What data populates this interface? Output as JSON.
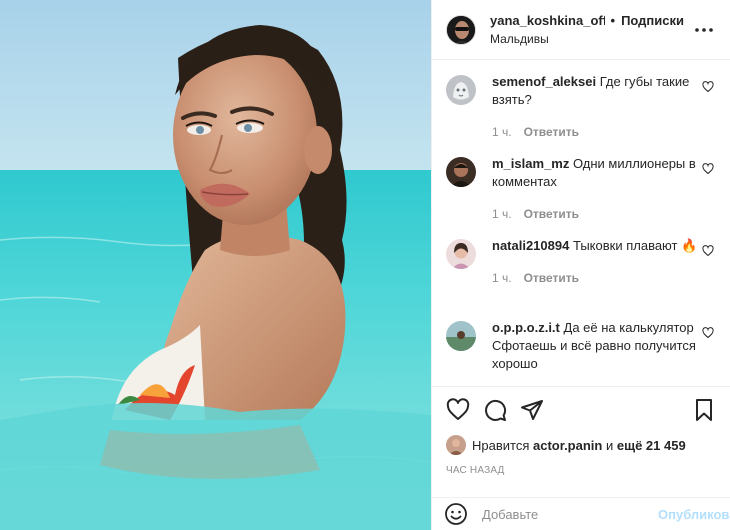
{
  "post": {
    "author": "yana_koshkina_offic",
    "separator": "•",
    "follow_label": "Подписки",
    "location": "Мальдивы",
    "more_icon": "more-horizontal-icon"
  },
  "comments": [
    {
      "username": "semenof_aleksei",
      "text": "Где губы такие взять?",
      "time": "1 ч.",
      "reply": "Ответить",
      "avatar_color": "#c9c9c9"
    },
    {
      "username": "m_islam_mz",
      "text": "Одни миллионеры в комментах",
      "time": "1 ч.",
      "reply": "Ответить",
      "avatar_color": "#5a4639"
    },
    {
      "username": "natali210894",
      "text": "Тыковки плавают 🔥",
      "time": "1 ч.",
      "reply": "Ответить",
      "avatar_color": "#e9d6d6"
    },
    {
      "username": "o.p.p.o.z.i.t",
      "text": "Да её на калькулятор Сфотаешь и всё равно получится хорошо",
      "avatar_color": "#6f8c6b"
    }
  ],
  "actions": {
    "like_icon": "heart-icon",
    "comment_icon": "comment-icon",
    "share_icon": "send-icon",
    "save_icon": "bookmark-icon"
  },
  "likes": {
    "prefix": "Нравится",
    "user": "actor.panin",
    "middle": "и",
    "rest": "ещё 21 459"
  },
  "time_ago": "ЧАС НАЗАД",
  "composer": {
    "placeholder": "Добавьте",
    "publish_label": "Опубликовать",
    "emoji_icon": "smile-icon"
  },
  "colors": {
    "primary_text": "#262626",
    "secondary_text": "#8e8e8e",
    "publish_disabled": "#b2dffc",
    "divider": "#efefef"
  }
}
